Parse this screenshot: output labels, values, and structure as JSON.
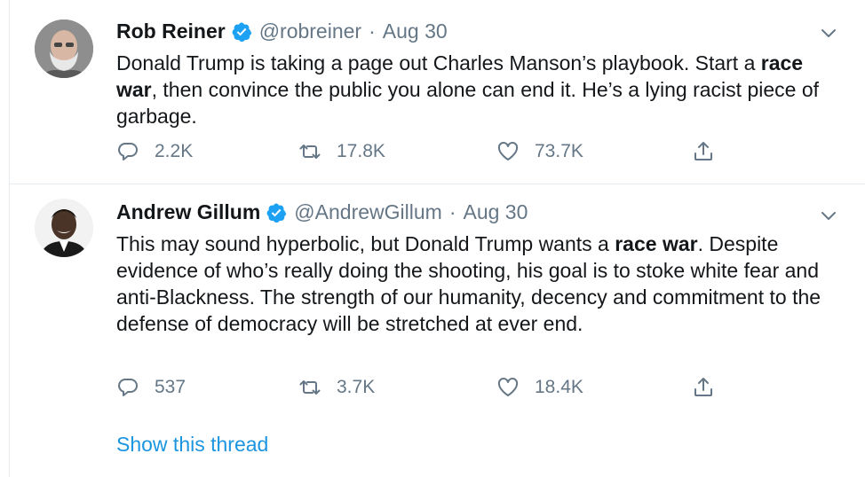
{
  "tweets": [
    {
      "name": "Rob Reiner",
      "handle": "@robreiner",
      "separator": "·",
      "date": "Aug 30",
      "text_segments": [
        {
          "text": "Donald Trump is taking a page out Charles Manson’s playbook. Start a ",
          "bold": false
        },
        {
          "text": "race war",
          "bold": true
        },
        {
          "text": ", then convince the public you alone can end it. He’s a lying racist piece of garbage.",
          "bold": false
        }
      ],
      "replies": "2.2K",
      "retweets": "17.8K",
      "likes": "73.7K"
    },
    {
      "name": "Andrew Gillum",
      "handle": "@AndrewGillum",
      "separator": "·",
      "date": "Aug 30",
      "text_segments": [
        {
          "text": "This may sound hyperbolic, but Donald Trump wants a ",
          "bold": false
        },
        {
          "text": "race war",
          "bold": true
        },
        {
          "text": ". Despite evidence of who’s really doing the shooting, his goal is to stoke white fear and anti-Blackness. The strength of our humanity, decency and commitment to the defense of democracy will be stretched at ever end.",
          "bold": false
        }
      ],
      "replies": "537",
      "retweets": "3.7K",
      "likes": "18.4K",
      "show_thread": "Show this thread"
    }
  ],
  "colors": {
    "text": "#14171a",
    "secondary": "#657786",
    "link": "#1b95e0",
    "verified": "#1da1f2",
    "divider": "#e6ecf0"
  },
  "icons": {
    "verified": "verified-badge-icon",
    "caret": "chevron-down-icon",
    "reply": "reply-icon",
    "retweet": "retweet-icon",
    "like": "heart-icon",
    "share": "share-icon"
  }
}
